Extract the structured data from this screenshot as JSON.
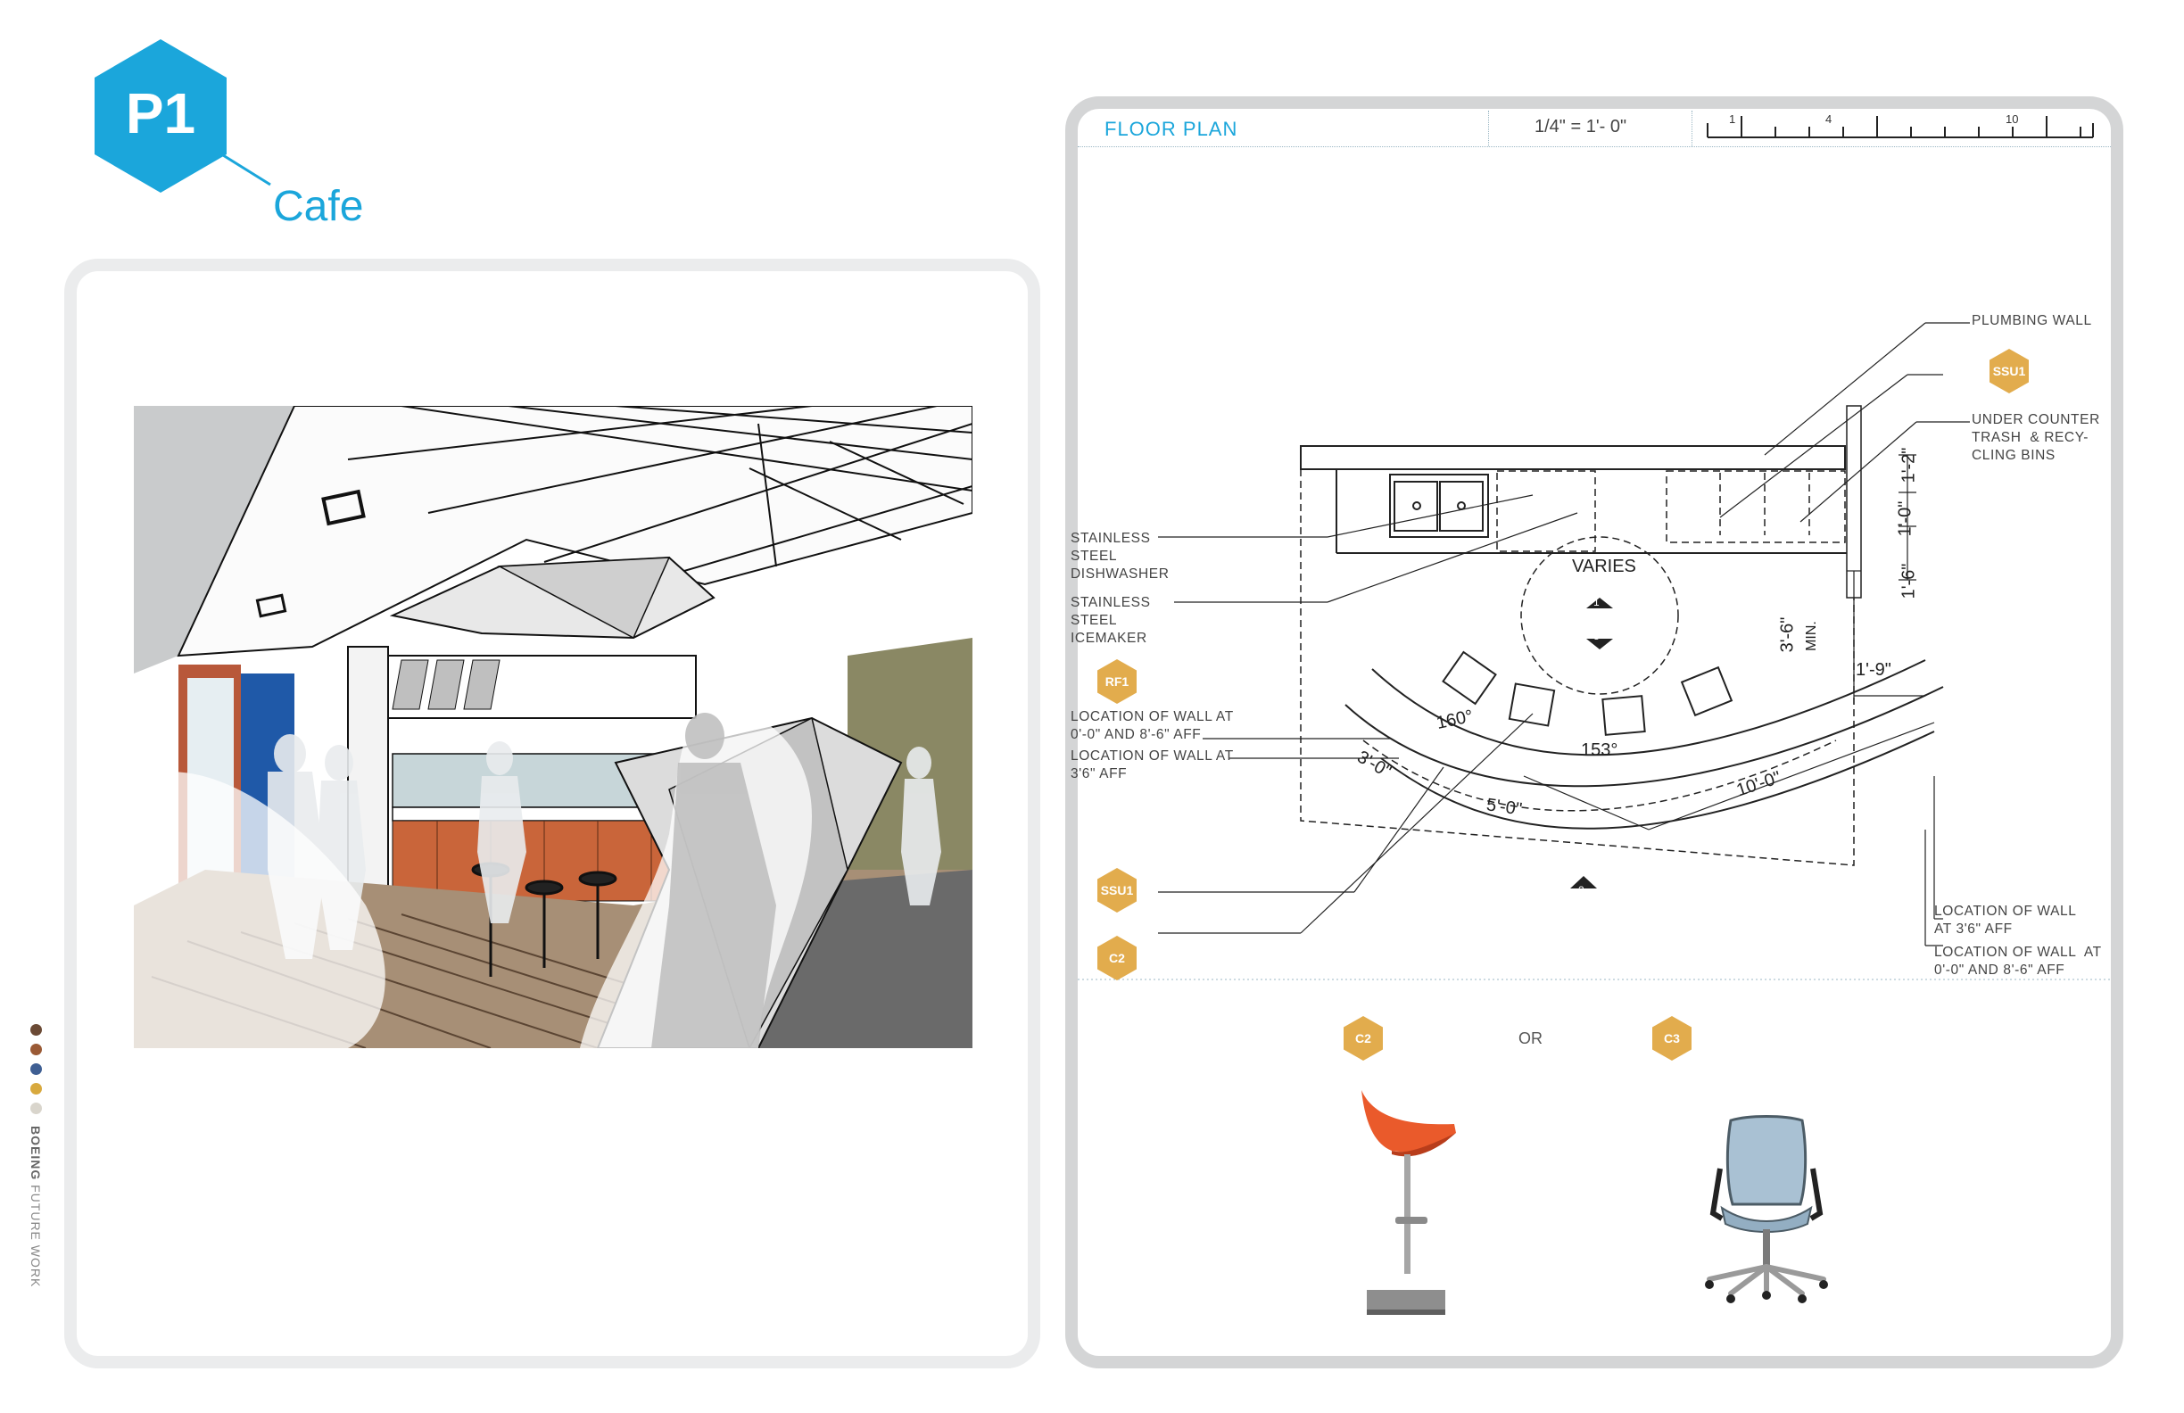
{
  "header": {
    "badge": "P1",
    "title": "Cafe"
  },
  "sidebar": {
    "brand": "BOEING",
    "subtitle": "FUTURE WORK",
    "swatches": [
      "#6b4a35",
      "#9a5a35",
      "#3f5f93",
      "#d8a93e",
      "#d9d5cc"
    ]
  },
  "floorplan": {
    "title": "FLOOR PLAN",
    "scale": "1/4\" = 1'- 0\"",
    "ruler_ticks": [
      "1",
      "4",
      "10"
    ],
    "labels": {
      "plumbing_wall": "PLUMBING WALL",
      "under_counter": "UNDER COUNTER\nTRASH  & RECY-\nCLING BINS",
      "dishwasher": "STAINLESS\nSTEEL\nDISHWASHER",
      "icemaker": "STAINLESS\nSTEEL\nICEMAKER",
      "wall_loc_1": "LOCATION OF WALL AT\n0'-0\" AND 8'-6\" AFF",
      "wall_loc_2": "LOCATION OF WALL AT\n3'6\" AFF",
      "wall_loc_3": "LOCATION OF WALL\nAT 3'6\" AFF",
      "wall_loc_4": "LOCATION OF WALL  AT\n0'-0\" AND 8'-6\" AFF",
      "varies": "VARIES",
      "min": "MIN."
    },
    "dimensions": {
      "d1": "1'-2\"",
      "d2": "1'-0\"",
      "d3": "1'-6\"",
      "d4": "3'-6\"",
      "d5": "1'-9\"",
      "a1": "160°",
      "a2": "153°",
      "d6": "3'-0\"",
      "d7": "5'-0\"",
      "d8": "10'-0\""
    },
    "markers": [
      "1",
      "3",
      "2"
    ],
    "tags": {
      "ssu1_top": "SSU1",
      "rf1": "RF1",
      "ssu1_left": "SSU1",
      "c2_left": "C2"
    }
  },
  "furniture": {
    "option_a": "C2",
    "or_label": "OR",
    "option_b": "C3"
  },
  "colors": {
    "accent_blue": "#1ba6db",
    "tag_gold": "#e2ac4d",
    "panel_border": "#d4d5d6"
  }
}
